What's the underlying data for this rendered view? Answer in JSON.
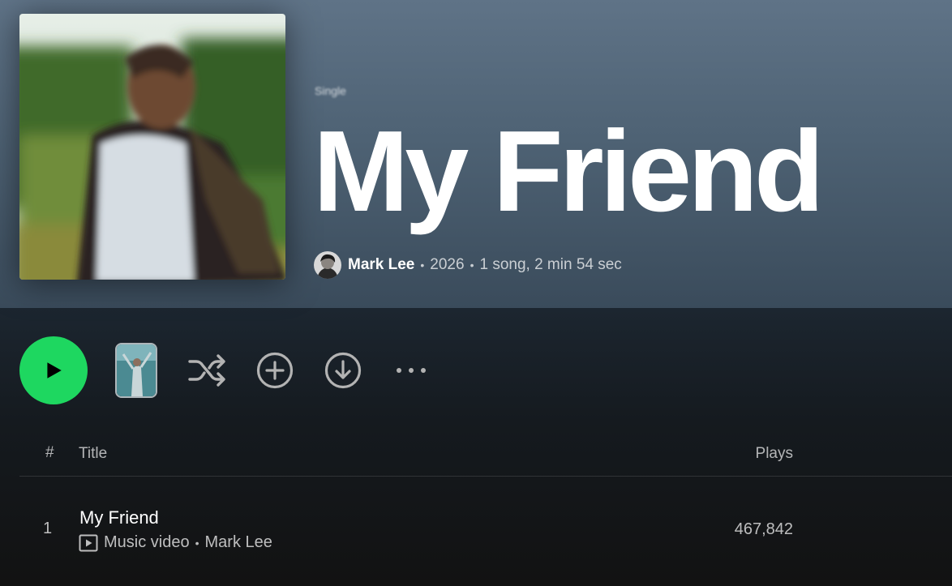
{
  "album": {
    "type_label": "Single",
    "title": "My Friend",
    "artist": "Mark Lee",
    "year": "2026",
    "summary": "1 song, 2 min 54 sec",
    "separator": "•"
  },
  "actions": {
    "play": "play-icon",
    "shuffle": "shuffle-icon",
    "add": "add-circle-icon",
    "download": "download-icon",
    "more": "more-icon"
  },
  "table": {
    "headers": {
      "number": "#",
      "title": "Title",
      "plays": "Plays"
    },
    "rows": [
      {
        "number": "1",
        "title": "My Friend",
        "type": "Music video",
        "artist": "Mark Lee",
        "plays": "467,842"
      }
    ]
  },
  "colors": {
    "accent": "#1ed760",
    "hero_top": "#5f7387",
    "background": "#121212"
  }
}
